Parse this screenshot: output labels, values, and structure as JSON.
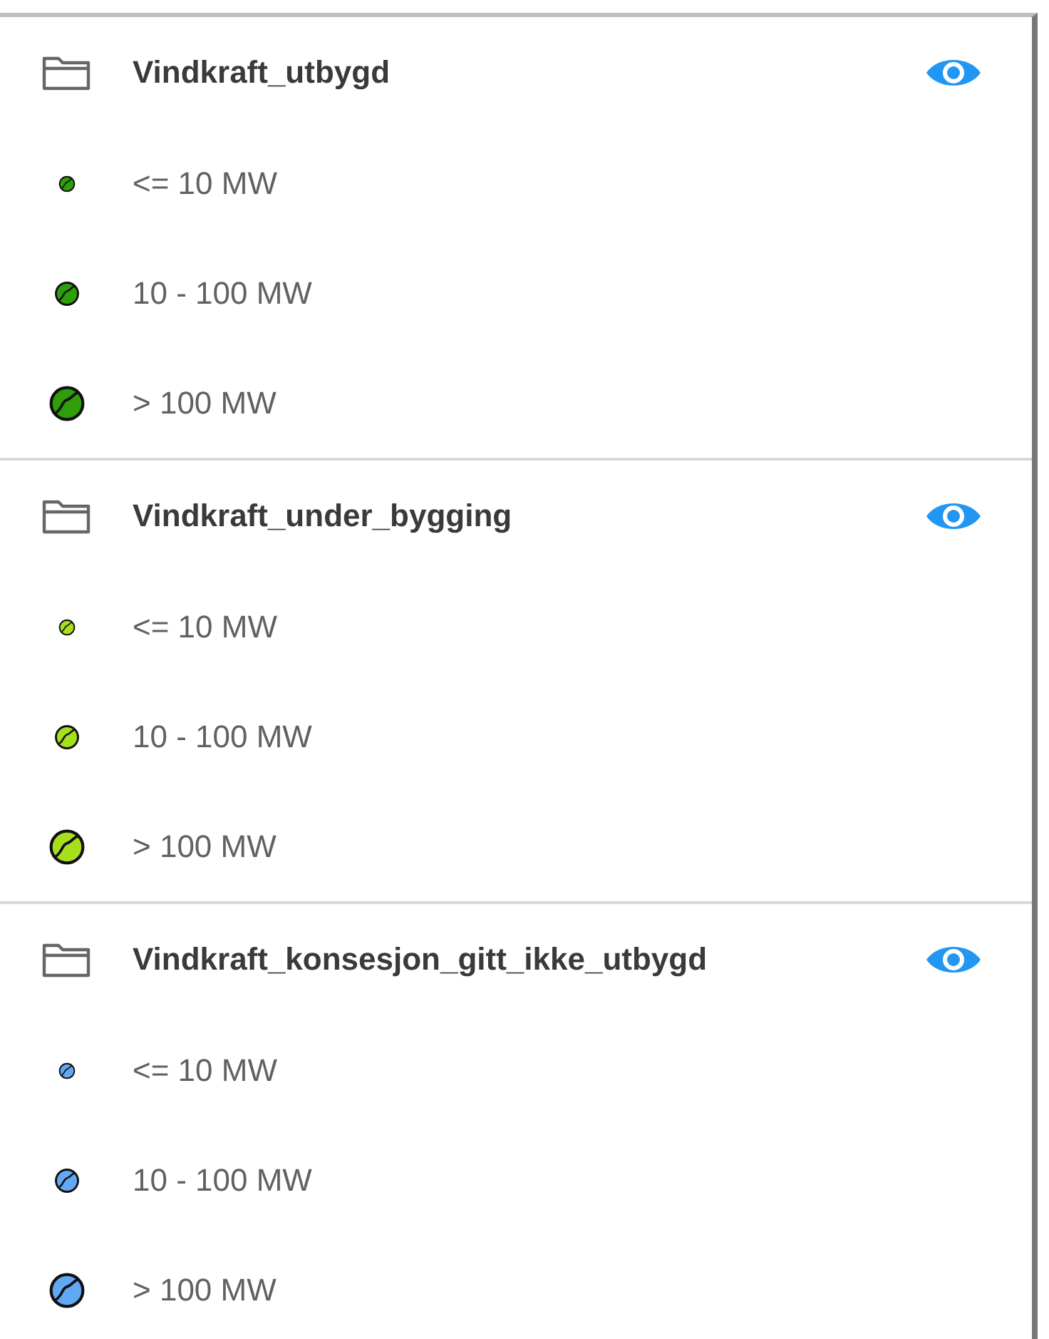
{
  "groups": [
    {
      "title": "Vindkraft_utbygd",
      "visible": true,
      "color": "#2e9e0a",
      "items": [
        {
          "label": "<= 10 MW",
          "kind": "small"
        },
        {
          "label": "10 - 100 MW",
          "kind": "medium"
        },
        {
          "label": "> 100 MW",
          "kind": "large"
        }
      ]
    },
    {
      "title": "Vindkraft_under_bygging",
      "visible": true,
      "color": "#a6e01c",
      "items": [
        {
          "label": "<= 10 MW",
          "kind": "small"
        },
        {
          "label": "10 - 100 MW",
          "kind": "medium"
        },
        {
          "label": "> 100 MW",
          "kind": "large"
        }
      ]
    },
    {
      "title": "Vindkraft_konsesjon_gitt_ikke_utbygd",
      "visible": true,
      "color": "#62a8f4",
      "items": [
        {
          "label": "<= 10 MW",
          "kind": "small"
        },
        {
          "label": "10 - 100 MW",
          "kind": "medium"
        },
        {
          "label": "> 100 MW",
          "kind": "large"
        }
      ]
    }
  ]
}
